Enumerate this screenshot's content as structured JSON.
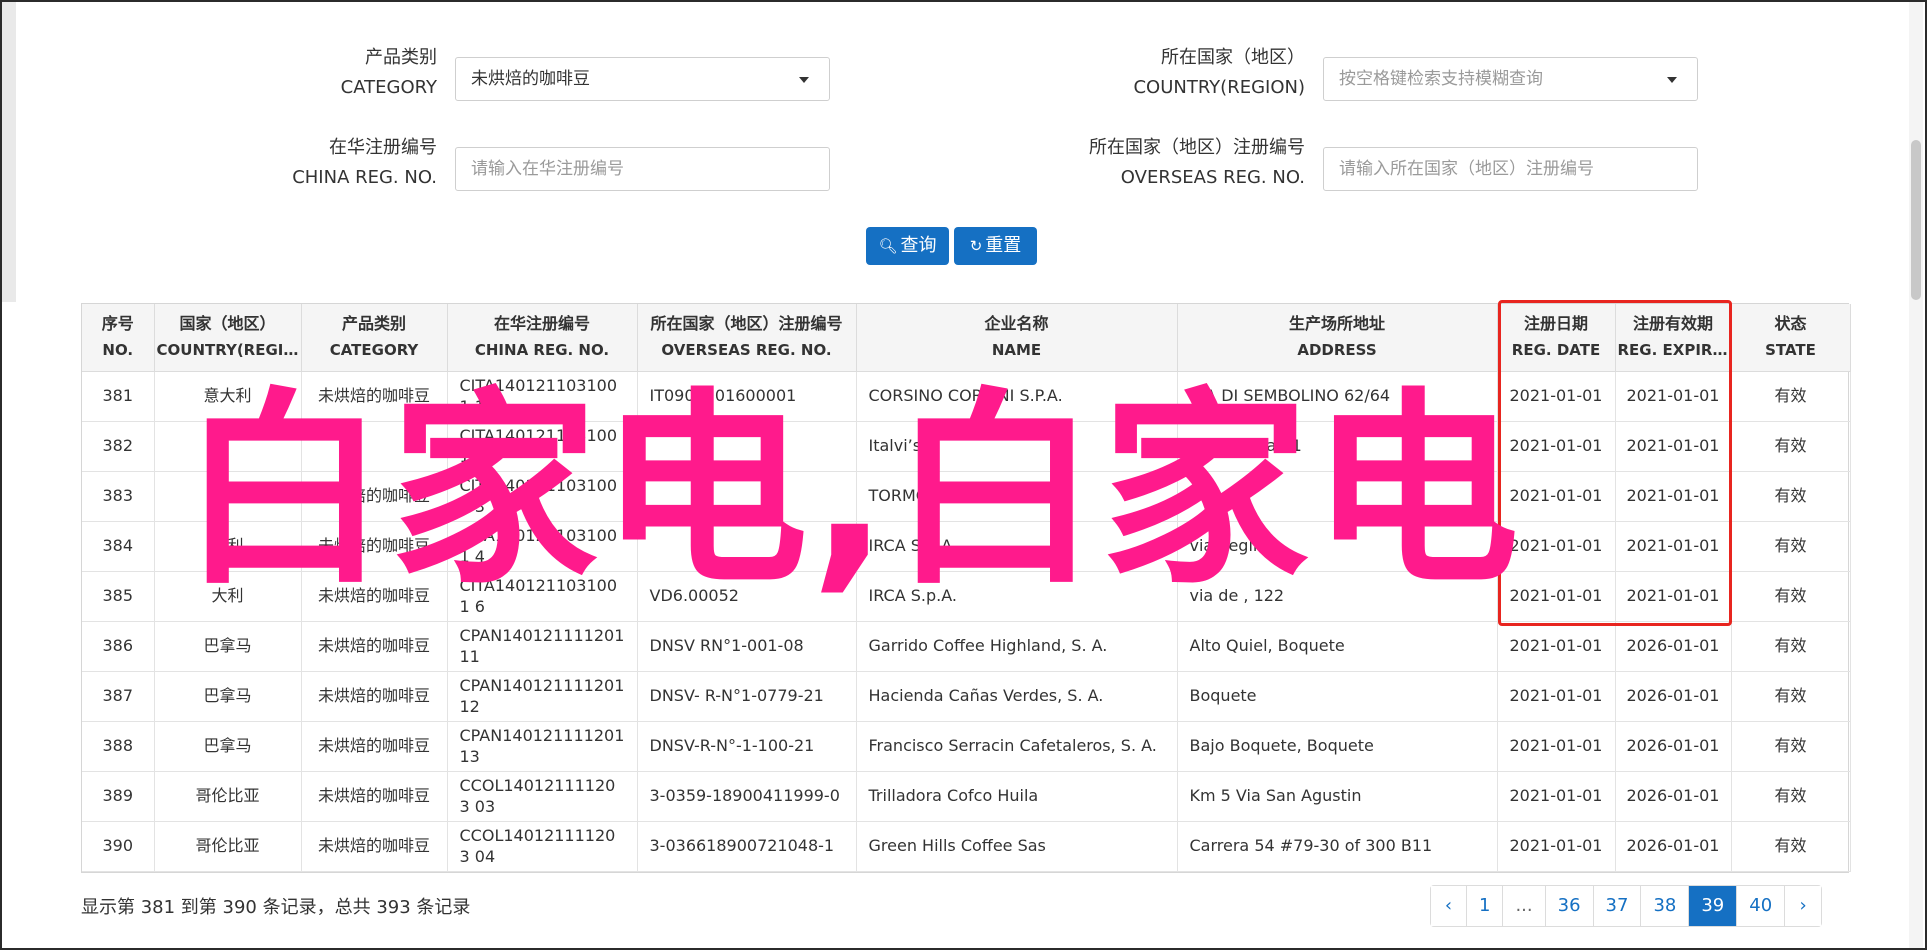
{
  "form": {
    "category": {
      "label_cn": "产品类别",
      "label_en": "CATEGORY",
      "value": "未烘焙的咖啡豆"
    },
    "country": {
      "label_cn": "所在国家（地区）",
      "label_en": "COUNTRY(REGION)",
      "placeholder": "按空格键检索支持模糊查询"
    },
    "china_reg": {
      "label_cn": "在华注册编号",
      "label_en": "CHINA REG. NO.",
      "placeholder": "请输入在华注册编号"
    },
    "overseas_reg": {
      "label_cn": "所在国家（地区）注册编号",
      "label_en": "OVERSEAS REG. NO.",
      "placeholder": "请输入所在国家（地区）注册编号"
    },
    "search_label": "查询",
    "reset_label": "重置"
  },
  "table": {
    "columns": [
      {
        "cn": "序号",
        "en": "NO."
      },
      {
        "cn": "国家（地区）",
        "en": "COUNTRY(REGIO..."
      },
      {
        "cn": "产品类别",
        "en": "CATEGORY"
      },
      {
        "cn": "在华注册编号",
        "en": "CHINA REG. NO."
      },
      {
        "cn": "所在国家（地区）注册编号",
        "en": "OVERSEAS REG. NO."
      },
      {
        "cn": "企业名称",
        "en": "NAME"
      },
      {
        "cn": "生产场所地址",
        "en": "ADDRESS"
      },
      {
        "cn": "注册日期",
        "en": "REG. DATE"
      },
      {
        "cn": "注册有效期",
        "en": "REG. EXPIRE ..."
      },
      {
        "cn": "状态",
        "en": "STATE"
      }
    ],
    "rows": [
      {
        "no": "381",
        "country": "意大利",
        "category": "未烘焙的咖啡豆",
        "china_reg": "CITA1401211031001 1",
        "overseas_reg": "IT0905101600001",
        "name": "CORSINO CORSINI S.P.A.",
        "address": "VIA DI SEMBOLINO 62/64",
        "reg_date": "2021-01-01",
        "expire": "2021-01-01",
        "state": "有效"
      },
      {
        "no": "382",
        "country": "",
        "category": "",
        "china_reg": "CITA1401211031001 2",
        "overseas_reg": "",
        "name": "Italvi’srl",
        "address": "via Trebbia 21",
        "reg_date": "2021-01-01",
        "expire": "2021-01-01",
        "state": "有效"
      },
      {
        "no": "383",
        "country": "大利",
        "category": "未烘焙的咖啡豆",
        "china_reg": "CITA1401211031001 3",
        "overseas_reg": "",
        "name": "TORMOKA",
        "address": "",
        "reg_date": "2021-01-01",
        "expire": "2021-01-01",
        "state": "有效"
      },
      {
        "no": "384",
        "country": "大利",
        "category": "未烘焙的咖啡豆",
        "china_reg": "CITA1401211031001 4",
        "overseas_reg": "",
        "name": "IRCA S.p.A.",
        "address": "via degli",
        "reg_date": "2021-01-01",
        "expire": "2021-01-01",
        "state": "有效"
      },
      {
        "no": "385",
        "country": "大利",
        "category": "未烘焙的咖啡豆",
        "china_reg": "CITA1401211031001 6",
        "overseas_reg": "VD6.00052",
        "name": "IRCA S.p.A.",
        "address": "via de , 122",
        "reg_date": "2021-01-01",
        "expire": "2021-01-01",
        "state": "有效"
      },
      {
        "no": "386",
        "country": "巴拿马",
        "category": "未烘焙的咖啡豆",
        "china_reg": "CPAN140121111201 11",
        "overseas_reg": "DNSV RN°1-001-08",
        "name": "Garrido Coffee Highland, S. A.",
        "address": "Alto Quiel, Boquete",
        "reg_date": "2021-01-01",
        "expire": "2026-01-01",
        "state": "有效"
      },
      {
        "no": "387",
        "country": "巴拿马",
        "category": "未烘焙的咖啡豆",
        "china_reg": "CPAN140121111201 12",
        "overseas_reg": "DNSV- R-N°1-0779-21",
        "name": "Hacienda Cañas Verdes, S. A.",
        "address": "Boquete",
        "reg_date": "2021-01-01",
        "expire": "2026-01-01",
        "state": "有效"
      },
      {
        "no": "388",
        "country": "巴拿马",
        "category": "未烘焙的咖啡豆",
        "china_reg": "CPAN140121111201 13",
        "overseas_reg": "DNSV-R-N°-1-100-21",
        "name": "Francisco Serracin Cafetaleros, S. A.",
        "address": "Bajo Boquete, Boquete",
        "reg_date": "2021-01-01",
        "expire": "2026-01-01",
        "state": "有效"
      },
      {
        "no": "389",
        "country": "哥伦比亚",
        "category": "未烘焙的咖啡豆",
        "china_reg": "CCOL140121111203 03",
        "overseas_reg": "3-0359-18900411999-0",
        "name": "Trilladora Cofco Huila",
        "address": "Km 5 Via San Agustin",
        "reg_date": "2021-01-01",
        "expire": "2026-01-01",
        "state": "有效"
      },
      {
        "no": "390",
        "country": "哥伦比亚",
        "category": "未烘焙的咖啡豆",
        "china_reg": "CCOL140121111203 04",
        "overseas_reg": "3-036618900721048-1",
        "name": "Green Hills Coffee Sas",
        "address": "Carrera 54 #79-30 of 300 B11",
        "reg_date": "2021-01-01",
        "expire": "2026-01-01",
        "state": "有效"
      }
    ]
  },
  "watermark": "白家电,白家电",
  "footer": {
    "summary": "显示第 381 到第 390 条记录，总共 393 条记录",
    "pages": [
      "‹",
      "1",
      "...",
      "36",
      "37",
      "38",
      "39",
      "40",
      "›"
    ],
    "active_page": "39"
  },
  "colors": {
    "accent": "#1570c3",
    "highlight_box": "#e8251f",
    "watermark": "#ff1a8c"
  }
}
